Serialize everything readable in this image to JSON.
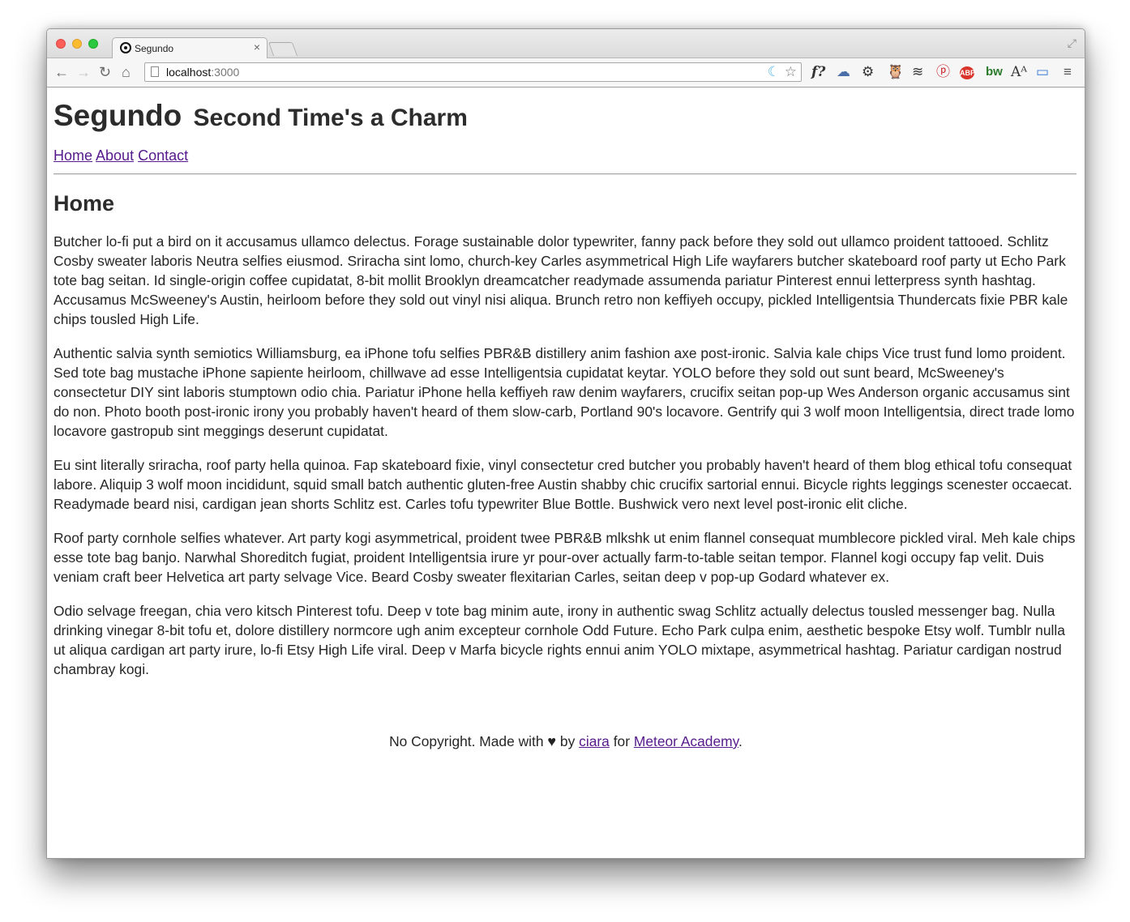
{
  "browser": {
    "tab_title": "Segundo",
    "tab_close": "×",
    "url_host": "localhost",
    "url_port": ":3000",
    "nav": {
      "back": "←",
      "forward": "→",
      "reload": "↻",
      "home": "⌂"
    },
    "extensions": [
      "f?",
      "☁",
      "⚙",
      "🦉",
      "≋",
      "ⓟ",
      "ABP",
      "bw",
      "Aᴬ",
      "▭",
      "≡"
    ]
  },
  "site": {
    "title": "Segundo",
    "tagline": "Second Time's a Charm",
    "nav": [
      {
        "label": "Home"
      },
      {
        "label": "About"
      },
      {
        "label": "Contact"
      }
    ]
  },
  "main": {
    "heading": "Home",
    "paragraphs": [
      "Butcher lo-fi put a bird on it accusamus ullamco delectus. Forage sustainable dolor typewriter, fanny pack before they sold out ullamco proident tattooed. Schlitz Cosby sweater laboris Neutra selfies eiusmod. Sriracha sint lomo, church-key Carles asymmetrical High Life wayfarers butcher skateboard roof party ut Echo Park tote bag seitan. Id single-origin coffee cupidatat, 8-bit mollit Brooklyn dreamcatcher readymade assumenda pariatur Pinterest ennui letterpress synth hashtag. Accusamus McSweeney's Austin, heirloom before they sold out vinyl nisi aliqua. Brunch retro non keffiyeh occupy, pickled Intelligentsia Thundercats fixie PBR kale chips tousled High Life.",
      "Authentic salvia synth semiotics Williamsburg, ea iPhone tofu selfies PBR&B distillery anim fashion axe post-ironic. Salvia kale chips Vice trust fund lomo proident. Sed tote bag mustache iPhone sapiente heirloom, chillwave ad esse Intelligentsia cupidatat keytar. YOLO before they sold out sunt beard, McSweeney's consectetur DIY sint laboris stumptown odio chia. Pariatur iPhone hella keffiyeh raw denim wayfarers, crucifix seitan pop-up Wes Anderson organic accusamus sint do non. Photo booth post-ironic irony you probably haven't heard of them slow-carb, Portland 90's locavore. Gentrify qui 3 wolf moon Intelligentsia, direct trade lomo locavore gastropub sint meggings deserunt cupidatat.",
      "Eu sint literally sriracha, roof party hella quinoa. Fap skateboard fixie, vinyl consectetur cred butcher you probably haven't heard of them blog ethical tofu consequat labore. Aliquip 3 wolf moon incididunt, squid small batch authentic gluten-free Austin shabby chic crucifix sartorial ennui. Bicycle rights leggings scenester occaecat. Readymade beard nisi, cardigan jean shorts Schlitz est. Carles tofu typewriter Blue Bottle. Bushwick vero next level post-ironic elit cliche.",
      "Roof party cornhole selfies whatever. Art party kogi asymmetrical, proident twee PBR&B mlkshk ut enim flannel consequat mumblecore pickled viral. Meh kale chips esse tote bag banjo. Narwhal Shoreditch fugiat, proident Intelligentsia irure yr pour-over actually farm-to-table seitan tempor. Flannel kogi occupy fap velit. Duis veniam craft beer Helvetica art party selvage Vice. Beard Cosby sweater flexitarian Carles, seitan deep v pop-up Godard whatever ex.",
      "Odio selvage freegan, chia vero kitsch Pinterest tofu. Deep v tote bag minim aute, irony in authentic swag Schlitz actually delectus tousled messenger bag. Nulla drinking vinegar 8-bit tofu et, dolore distillery normcore ugh anim excepteur cornhole Odd Future. Echo Park culpa enim, aesthetic bespoke Etsy wolf. Tumblr nulla ut aliqua cardigan art party irure, lo-fi Etsy High Life viral. Deep v Marfa bicycle rights ennui anim YOLO mixtape, asymmetrical hashtag. Pariatur cardigan nostrud chambray kogi."
    ]
  },
  "footer": {
    "prefix": "No Copyright. Made with",
    "heart": "♥",
    "by": "by",
    "author": "ciara",
    "for": "for",
    "org": "Meteor Academy",
    "suffix": "."
  },
  "colors": {
    "link": "#551a8b",
    "text": "#262626",
    "heading": "#2c2c2c"
  }
}
